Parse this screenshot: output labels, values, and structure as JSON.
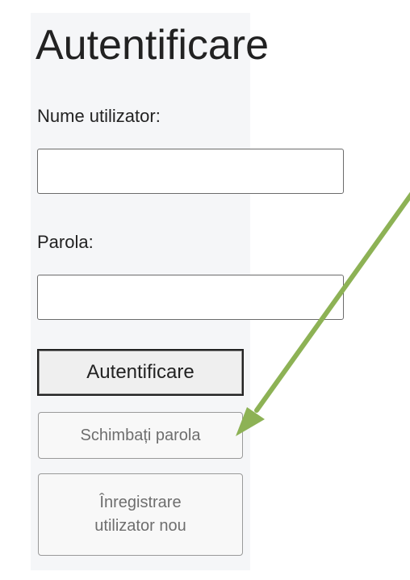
{
  "login_form": {
    "title": "Autentificare",
    "username_label": "Nume utilizator:",
    "username_value": "",
    "password_label": "Parola:",
    "password_value": "",
    "login_button": "Autentificare",
    "change_password_button": "Schimbați parola",
    "register_button_line1": "Înregistrare",
    "register_button_line2": "utilizator nou"
  },
  "annotation": {
    "arrow_color": "#8db255"
  }
}
